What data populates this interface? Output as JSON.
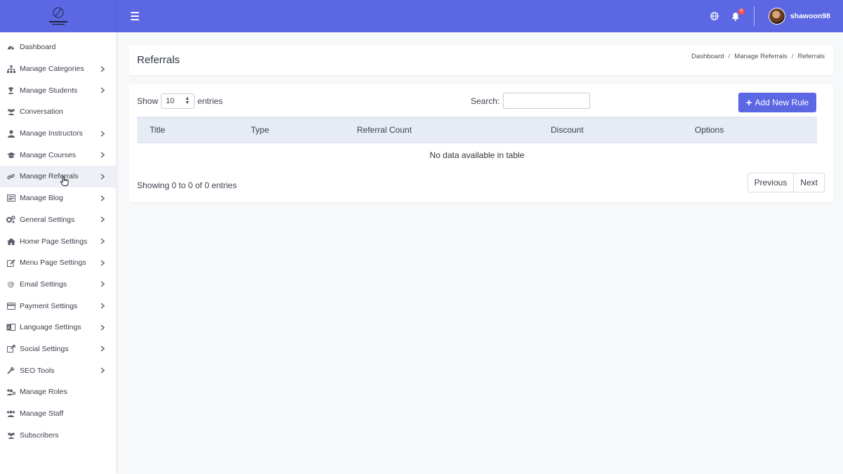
{
  "brand": {
    "colors": {
      "primary": "#5b67e3",
      "sidebar_bg": "#ffffff",
      "active_item_bg": "#eef0f5",
      "table_header_bg": "#e7ebf5",
      "badge": "#ff4d4f"
    }
  },
  "sidebar": {
    "items": [
      {
        "label": "Dashboard",
        "icon": "dashboard-icon",
        "has_chevron": false
      },
      {
        "label": "Manage Categories",
        "icon": "sitemap-icon",
        "has_chevron": true
      },
      {
        "label": "Manage Students",
        "icon": "student-icon",
        "has_chevron": true
      },
      {
        "label": "Conversation",
        "icon": "users-icon",
        "has_chevron": false
      },
      {
        "label": "Manage Instructors",
        "icon": "user-icon",
        "has_chevron": true
      },
      {
        "label": "Manage Courses",
        "icon": "graduation-cap-icon",
        "has_chevron": true
      },
      {
        "label": "Manage Referrals",
        "icon": "link-icon",
        "has_chevron": true,
        "active": true
      },
      {
        "label": "Manage Blog",
        "icon": "blog-icon",
        "has_chevron": true
      },
      {
        "label": "General Settings",
        "icon": "cogs-icon",
        "has_chevron": true
      },
      {
        "label": "Home Page Settings",
        "icon": "home-icon",
        "has_chevron": true
      },
      {
        "label": "Menu Page Settings",
        "icon": "edit-icon",
        "has_chevron": true
      },
      {
        "label": "Email Settings",
        "icon": "at-icon",
        "has_chevron": true
      },
      {
        "label": "Payment Settings",
        "icon": "payment-icon",
        "has_chevron": true
      },
      {
        "label": "Language Settings",
        "icon": "language-icon",
        "has_chevron": true
      },
      {
        "label": "Social Settings",
        "icon": "share-icon",
        "has_chevron": true
      },
      {
        "label": "SEO Tools",
        "icon": "wrench-icon",
        "has_chevron": true
      },
      {
        "label": "Manage Roles",
        "icon": "users-cog-icon",
        "has_chevron": false
      },
      {
        "label": "Manage Staff",
        "icon": "group-icon",
        "has_chevron": false
      },
      {
        "label": "Subscribers",
        "icon": "users-icon",
        "has_chevron": false
      }
    ]
  },
  "topbar": {
    "notification_count": "0",
    "username": "shawoon98"
  },
  "header": {
    "title": "Referrals",
    "breadcrumb": [
      "Dashboard",
      "Manage Referrals",
      "Referrals"
    ]
  },
  "table_controls": {
    "show_label": "Show",
    "entries_value": "10",
    "entries_label": "entries",
    "search_label": "Search:",
    "search_value": "",
    "add_button": "Add New Rule"
  },
  "table": {
    "columns": [
      "Title",
      "Type",
      "Referral Count",
      "Discount",
      "Options"
    ],
    "empty_message": "No data available in table",
    "info": "Showing 0 to 0 of 0 entries",
    "pagination": {
      "previous": "Previous",
      "next": "Next"
    }
  }
}
